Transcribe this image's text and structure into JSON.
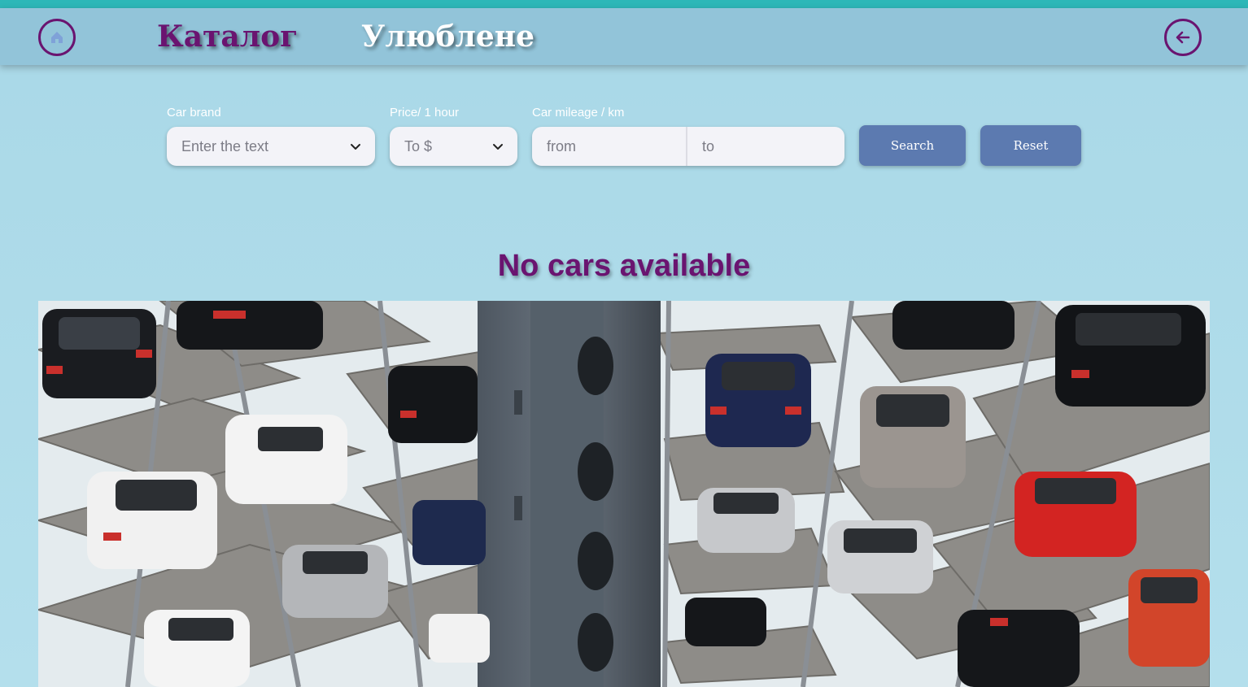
{
  "header": {
    "home_icon": "home-icon",
    "back_icon": "arrow-left-icon",
    "nav": {
      "catalog": "Каталог",
      "favorites": "Улюблене"
    }
  },
  "filters": {
    "brand": {
      "label": "Car brand",
      "placeholder": "Enter the text"
    },
    "price": {
      "label": "Price/ 1 hour",
      "placeholder": "To $"
    },
    "mileage": {
      "label": "Car mileage / km",
      "from_placeholder": "from",
      "to_placeholder": "to"
    },
    "search_label": "Search",
    "reset_label": "Reset"
  },
  "main": {
    "empty_message": "No cars available",
    "hero_image": "multi-storey-car-parking-tower"
  },
  "colors": {
    "accent_purple": "#6a1470",
    "header_bg": "#92c4d9",
    "button_bg": "#5c7ab0",
    "top_line": "#2db7b8"
  }
}
